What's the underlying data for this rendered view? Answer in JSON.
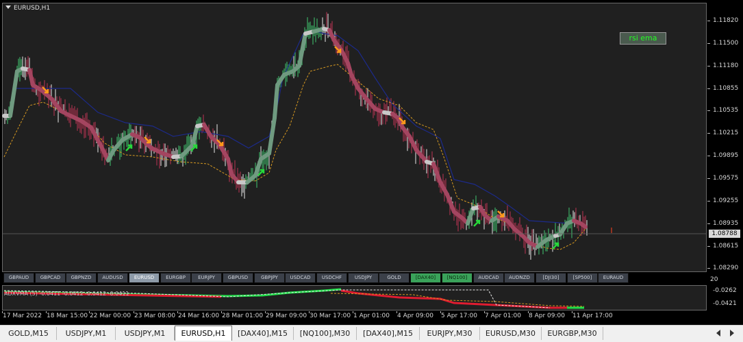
{
  "chart": {
    "title": "EURUSD,H1",
    "indicator_button": "rsi ema",
    "current_price": "1.08788",
    "subwindow_label": "ADXVMA (5)  -0.0411 -0.0412 -0.0412 -0.0411",
    "subwindow_scale_top": "20",
    "subwindow_levels": [
      "-0.0262",
      "-0.0421"
    ],
    "colors": {
      "background": "#202020",
      "up": "#3fb86a",
      "down": "#b0344f",
      "neutral": "#d8d8d8",
      "envelope_upper": "#1c2a8a",
      "envelope_lower": "#d89a20"
    }
  },
  "price_axis": [
    "1.11820",
    "1.11500",
    "1.11180",
    "1.10855",
    "1.10535",
    "1.10215",
    "1.09895",
    "1.09575",
    "1.09255",
    "1.08935",
    "1.08615",
    "1.08290"
  ],
  "time_axis": [
    "17 Mar 2022",
    "18 Mar 15:00",
    "22 Mar 00:00",
    "23 Mar 08:00",
    "24 Mar 16:00",
    "28 Mar 01:00",
    "29 Mar 09:00",
    "30 Mar 17:00",
    "1 Apr 01:00",
    "4 Apr 09:00",
    "5 Apr 17:00",
    "7 Apr 01:00",
    "8 Apr 09:00",
    "11 Apr 17:00"
  ],
  "symbol_buttons": [
    {
      "label": "GBPAUD",
      "state": "normal"
    },
    {
      "label": "GBPCAD",
      "state": "normal"
    },
    {
      "label": "GBPNZD",
      "state": "normal"
    },
    {
      "label": "AUDUSD",
      "state": "normal"
    },
    {
      "label": "EURUSD",
      "state": "active"
    },
    {
      "label": "EURGBP",
      "state": "normal"
    },
    {
      "label": "EURJPY",
      "state": "normal"
    },
    {
      "label": "GBPUSD",
      "state": "normal"
    },
    {
      "label": "GBPJPY",
      "state": "normal"
    },
    {
      "label": "USDCAD",
      "state": "normal"
    },
    {
      "label": "USDCHF",
      "state": "normal"
    },
    {
      "label": "USDJPY",
      "state": "normal"
    },
    {
      "label": "GOLD",
      "state": "normal"
    },
    {
      "label": "[DAX40]",
      "state": "green"
    },
    {
      "label": "[NQ100]",
      "state": "green"
    },
    {
      "label": "AUDCAD",
      "state": "normal"
    },
    {
      "label": "AUDNZD",
      "state": "normal"
    },
    {
      "label": "[DJI30]",
      "state": "normal"
    },
    {
      "label": "[SP500]",
      "state": "normal"
    },
    {
      "label": "EURAUD",
      "state": "normal"
    }
  ],
  "tabs": [
    {
      "label": "GOLD,M15",
      "active": false
    },
    {
      "label": "USDJPY,M1",
      "active": false
    },
    {
      "label": "USDJPY,M1",
      "active": false
    },
    {
      "label": "EURUSD,H1",
      "active": true
    },
    {
      "label": "[DAX40],M15",
      "active": false
    },
    {
      "label": "[NQ100],M30",
      "active": false
    },
    {
      "label": "[DAX40],M15",
      "active": false
    },
    {
      "label": "EURJPY,M30",
      "active": false
    },
    {
      "label": "EURUSD,M30",
      "active": false
    },
    {
      "label": "EURGBP,M30",
      "active": false
    }
  ]
}
